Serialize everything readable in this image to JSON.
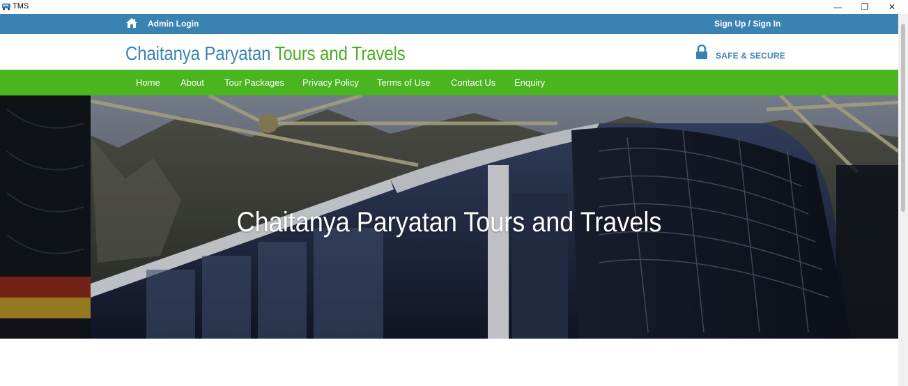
{
  "window": {
    "title": "TMS",
    "controls": {
      "minimize": "—",
      "maximize": "❐",
      "close": "✕"
    }
  },
  "topbar": {
    "admin_label": "Admin Login",
    "signin_label": "Sign Up / Sign In"
  },
  "brand": {
    "part1": "Chaitanya Paryatan",
    "part2": "Tours and Travels",
    "secure_label": "SAFE & SECURE"
  },
  "nav": {
    "items": [
      {
        "label": "Home"
      },
      {
        "label": "About"
      },
      {
        "label": "Tour Packages"
      },
      {
        "label": "Privacy Policy"
      },
      {
        "label": "Terms of Use"
      },
      {
        "label": "Contact Us"
      },
      {
        "label": "Enquiry"
      }
    ]
  },
  "hero": {
    "title": "Chaitanya Paryatan Tours and Travels"
  },
  "colors": {
    "topbar": "#3a82b2",
    "navbar": "#4bb51f",
    "brand_blue": "#3a82b2",
    "brand_green": "#4bae20"
  },
  "icons": {
    "home": "home-icon",
    "lock": "lock-icon",
    "app": "tms-app-icon"
  }
}
